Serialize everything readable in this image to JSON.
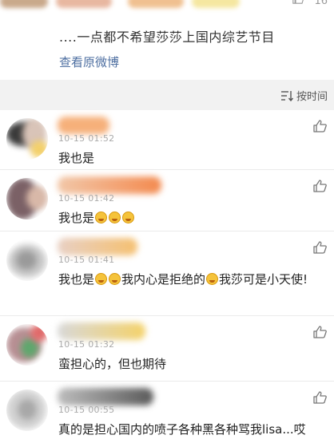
{
  "post": {
    "like_count": "16",
    "excerpt": "....一点都不希望莎莎上国内综艺节目",
    "view_original": "查看原微博"
  },
  "sort": {
    "label": "按时间",
    "icon": "sort-lines-icon"
  },
  "comments": [
    {
      "time": "10-15 01:52",
      "text": "我也是"
    },
    {
      "time": "10-15 01:42",
      "text": "我也是"
    },
    {
      "time": "10-15 01:41",
      "text_a": "我也是",
      "text_b": "我内心是拒绝的",
      "text_c": "我莎可是小天使!"
    },
    {
      "time": "10-15 01:32",
      "text": "蛮担心的，但也期待"
    },
    {
      "time": "10-15 00:55",
      "text": "真的是担心国内的喷子各种黑各种骂我lisa...哎"
    }
  ],
  "icons": {
    "like": "thumbs-up-icon",
    "emoji": "crying-face-emoji"
  },
  "colors": {
    "link": "#4e6fa1",
    "timestamp": "#aaaaaa",
    "background": "#f2f2f2"
  }
}
